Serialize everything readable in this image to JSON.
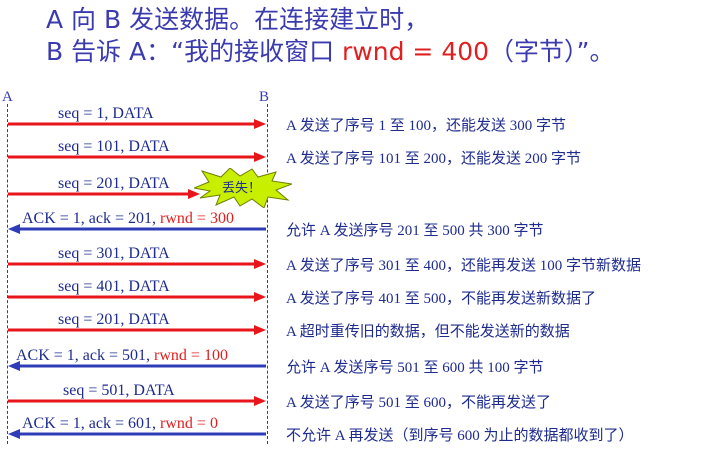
{
  "header": {
    "line1": "A 向 B 发送数据。在连接建立时，",
    "line2_pre": "B 告诉 A：“我的接收窗口 ",
    "line2_red": "rwnd = 400",
    "line2_post": "（字节）”。"
  },
  "endpoints": {
    "a": "A",
    "b": "B"
  },
  "messages": [
    {
      "text": "seq = 1, DATA",
      "dir": "A→B",
      "desc": "A 发送了序号 1 至 100，还能发送 300 字节"
    },
    {
      "text": "seq = 101, DATA",
      "dir": "A→B",
      "desc": "A 发送了序号 101 至 200，还能发送 200 字节"
    },
    {
      "text": "seq = 201, DATA",
      "dir": "A→B",
      "lost": true,
      "lost_label": "丢失！"
    },
    {
      "text": "ACK = 1, ack = 201, ",
      "rwnd": "rwnd = 300",
      "dir": "B→A",
      "desc": "允许 A 发送序号 201 至 500  共 300 字节"
    },
    {
      "text": "seq = 301, DATA",
      "dir": "A→B",
      "desc": "A 发送了序号 301 至 400，还能再发送 100 字节新数据"
    },
    {
      "text": "seq = 401, DATA",
      "dir": "A→B",
      "desc": "A 发送了序号 401 至 500，不能再发送新数据了"
    },
    {
      "text": "seq = 201, DATA",
      "dir": "A→B",
      "desc": "A 超时重传旧的数据，但不能发送新的数据"
    },
    {
      "text": "ACK = 1, ack = 501, ",
      "rwnd": "rwnd = 100",
      "dir": "B→A",
      "desc": "允许 A 发送序号 501 至 600 共 100 字节"
    },
    {
      "text": "seq = 501, DATA",
      "dir": "A→B",
      "desc": "A 发送了序号 501 至 600，不能再发送了"
    },
    {
      "text": "ACK = 1, ack = 601, ",
      "rwnd": "rwnd = 0",
      "dir": "B→A",
      "desc": "不允许 A 再发送（到序号 600 为止的数据都收到了）"
    }
  ],
  "colors": {
    "data_arrow": "#e8161b",
    "ack_arrow": "#2f3cb8",
    "text": "#1e2b8f",
    "burst": "#c8ee00"
  }
}
